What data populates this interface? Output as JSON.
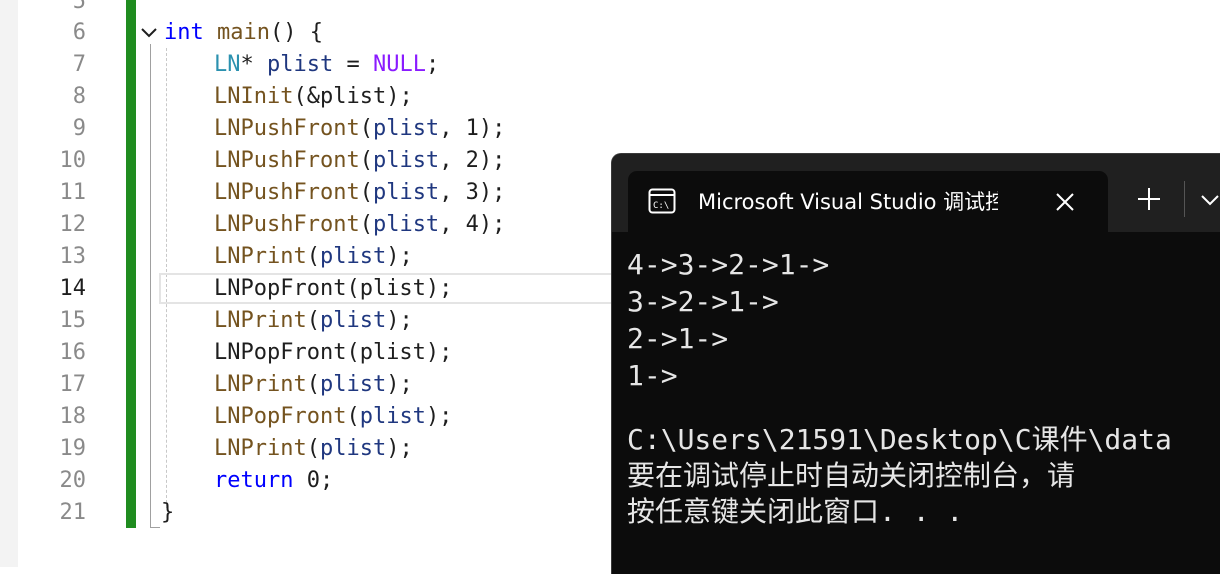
{
  "editor": {
    "partial_top_line_number": "5",
    "lines": [
      {
        "n": "6"
      },
      {
        "n": "7"
      },
      {
        "n": "8"
      },
      {
        "n": "9"
      },
      {
        "n": "10"
      },
      {
        "n": "11"
      },
      {
        "n": "12"
      },
      {
        "n": "13"
      },
      {
        "n": "14"
      },
      {
        "n": "15"
      },
      {
        "n": "16"
      },
      {
        "n": "17"
      },
      {
        "n": "18"
      },
      {
        "n": "19"
      },
      {
        "n": "20"
      },
      {
        "n": "21"
      }
    ],
    "code": {
      "l6": {
        "kw": "int",
        "fn": "main",
        "rest": "() {"
      },
      "l7": {
        "type": "LN",
        "star": "* ",
        "var": "plist",
        "eq": " = ",
        "mac": "NULL",
        "end": ";"
      },
      "l8": {
        "fn": "LNInit",
        "args": "(&plist);"
      },
      "l9": {
        "fn": "LNPushFront",
        "open": "(",
        "var": "plist",
        "args": ", 1);"
      },
      "l10": {
        "fn": "LNPushFront",
        "open": "(",
        "var": "plist",
        "args": ", 2);"
      },
      "l11": {
        "fn": "LNPushFront",
        "open": "(",
        "var": "plist",
        "args": ", 3);"
      },
      "l12": {
        "fn": "LNPushFront",
        "open": "(",
        "var": "plist",
        "args": ", 4);"
      },
      "l13": {
        "fn": "LNPrint",
        "open": "(",
        "var": "plist",
        "args": ");"
      },
      "l14": {
        "text": "LNPopFront(plist);"
      },
      "l15": {
        "fn": "LNPrint",
        "open": "(",
        "var": "plist",
        "args": ");"
      },
      "l16": {
        "text": "LNPopFront(plist);"
      },
      "l17": {
        "fn": "LNPrint",
        "open": "(",
        "var": "plist",
        "args": ");"
      },
      "l18": {
        "fn": "LNPopFront",
        "open": "(",
        "var": "plist",
        "args": ");"
      },
      "l19": {
        "fn": "LNPrint",
        "open": "(",
        "var": "plist",
        "args": ");"
      },
      "l20": {
        "kw": "return",
        "rest": " 0;"
      },
      "l21": {
        "text": "}"
      }
    },
    "current_line": "14",
    "change_bar_color": "#1f8c1f"
  },
  "terminal": {
    "tab_title": "Microsoft Visual Studio 调试控制台",
    "tab_icon": "terminal-icon",
    "close_icon": "close-icon",
    "new_tab_icon": "plus-icon",
    "dropdown_icon": "chevron-down-icon",
    "output": [
      "4->3->2->1->",
      "3->2->1->",
      "2->1->",
      "1->",
      "",
      "C:\\Users\\21591\\Desktop\\C课件\\data",
      "要在调试停止时自动关闭控制台，请",
      "按任意键关闭此窗口. . ."
    ]
  }
}
